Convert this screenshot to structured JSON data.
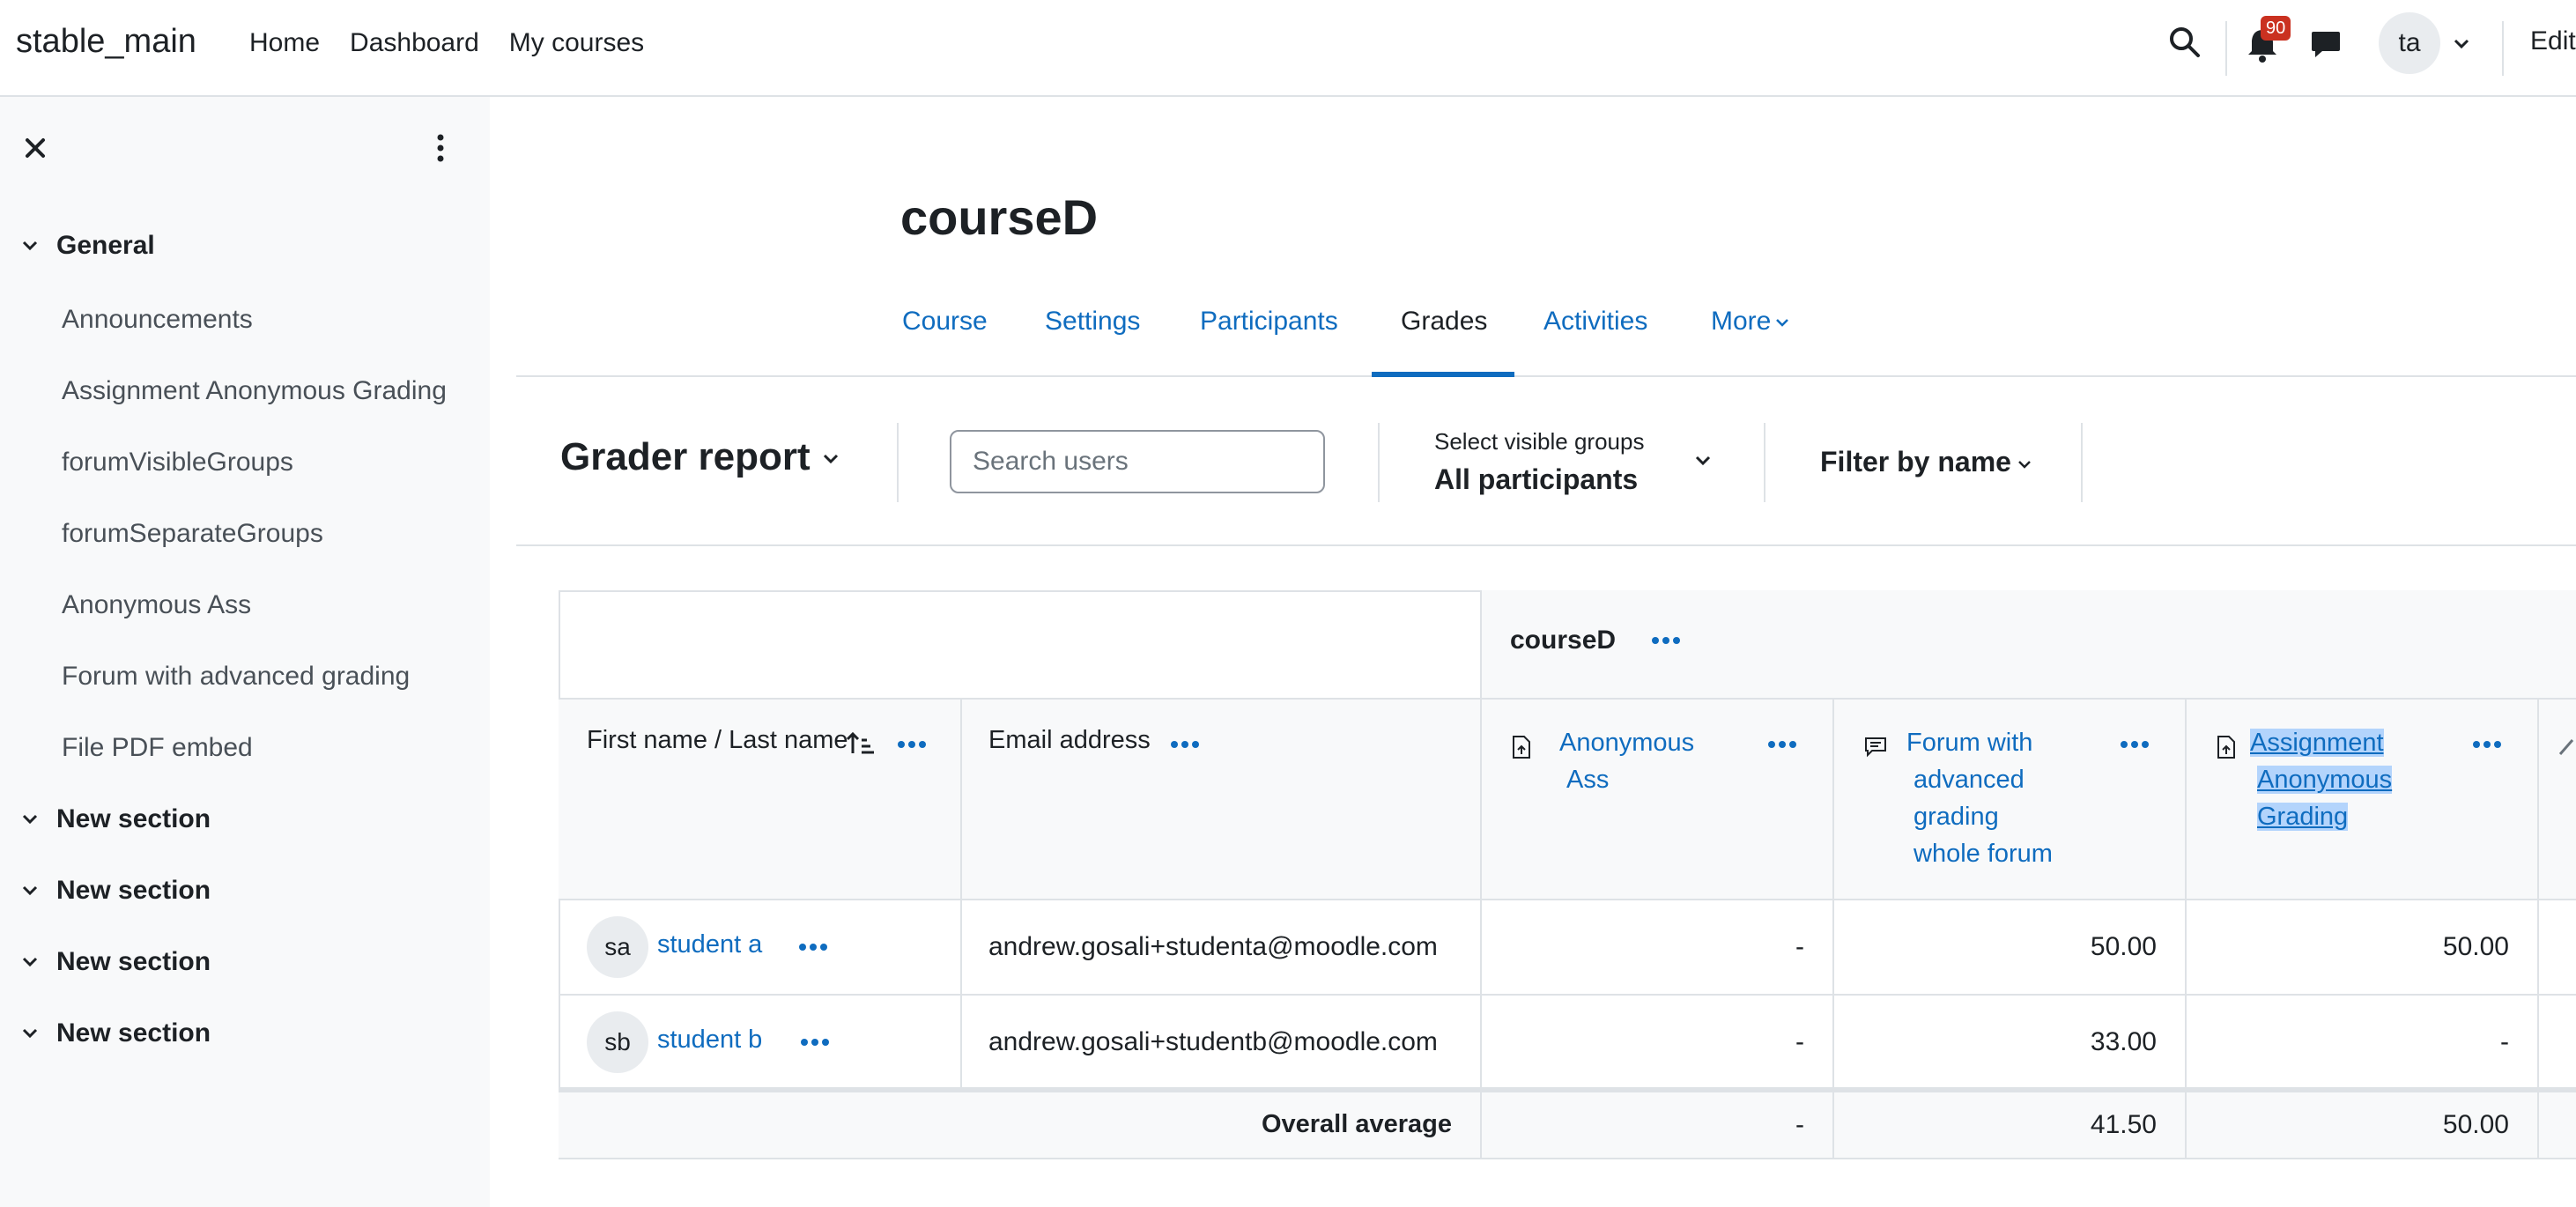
{
  "navbar": {
    "brand": "stable_main",
    "links": [
      "Home",
      "Dashboard",
      "My courses"
    ],
    "notification_count": "90",
    "avatar_initials": "ta",
    "edit_label": "Edit"
  },
  "drawer": {
    "sections": [
      {
        "label": "General",
        "activities": [
          "Announcements",
          "Assignment Anonymous Grading",
          "forumVisibleGroups",
          "forumSeparateGroups",
          "Anonymous Ass",
          "Forum with advanced grading",
          "File PDF embed"
        ]
      },
      {
        "label": "New section"
      },
      {
        "label": "New section"
      },
      {
        "label": "New section"
      },
      {
        "label": "New section"
      }
    ]
  },
  "page": {
    "title": "courseD",
    "tabs": [
      "Course",
      "Settings",
      "Participants",
      "Grades",
      "Activities",
      "More"
    ],
    "active_tab": "Grades"
  },
  "action_bar": {
    "report_title": "Grader report",
    "search_placeholder": "Search users",
    "groups_caption": "Select visible groups",
    "groups_value": "All participants",
    "filter_label": "Filter by name"
  },
  "grader": {
    "category_name": "courseD",
    "col_name": "First name / Last name",
    "col_email": "Email address",
    "items": [
      {
        "lines": [
          "Anonymous",
          "Ass"
        ]
      },
      {
        "lines": [
          "Forum with",
          "advanced",
          "grading",
          "whole forum"
        ]
      },
      {
        "lines": [
          "Assignment",
          "Anonymous",
          "Grading"
        ]
      }
    ],
    "rows": [
      {
        "initials": "sa",
        "name": "student a",
        "email": "andrew.gosali+studenta@moodle.com",
        "grades": [
          "-",
          "50.00",
          "50.00"
        ]
      },
      {
        "initials": "sb",
        "name": "student b",
        "email": "andrew.gosali+studentb@moodle.com",
        "grades": [
          "-",
          "33.00",
          "-"
        ]
      }
    ],
    "average_label": "Overall average",
    "averages": [
      "-",
      "41.50",
      "50.00"
    ]
  },
  "colors": {
    "link": "#0f6cbf",
    "badge": "#ca3120",
    "drawer_bg": "#f8f9fa",
    "border": "#dee2e6"
  }
}
